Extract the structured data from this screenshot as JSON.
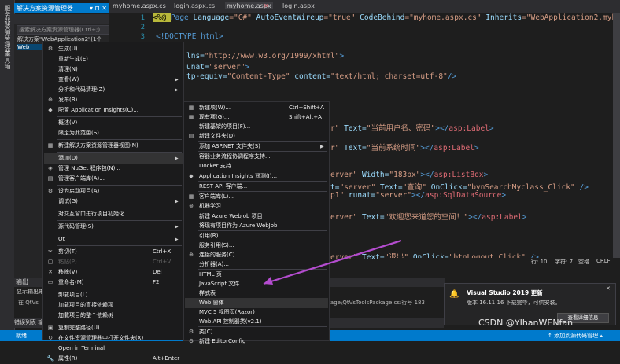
{
  "left_strip": {
    "label1": "服务器资源管理器",
    "label2": "工具箱"
  },
  "solution_explorer": {
    "title": "解决方案资源管理器",
    "search_placeholder": "搜索解决方案资源管理器(Ctrl+;)",
    "solution_label": "解决方案\"WebApplication2\"(1个",
    "project_label": "Web",
    "controls": "▾ ⊓ ✕"
  },
  "tabs": [
    {
      "label": "myhome.aspx.cs"
    },
    {
      "label": "login.aspx.cs"
    },
    {
      "label": "myhome.aspx"
    },
    {
      "label": "login.aspx"
    }
  ],
  "tab_close": "✕",
  "line_numbers": [
    "1",
    "2",
    "3"
  ],
  "code": {
    "line1": [
      "<%@ ",
      "Page ",
      "Language",
      "=\"C#\" ",
      "AutoEventWireup",
      "=\"true\" ",
      "CodeBehind",
      "=\"myhome.aspx.cs\" ",
      "Inherits",
      "=\"WebApplication2.myhome\" ",
      "%>"
    ],
    "line3": "<!DOCTYPE html>",
    "l_xmlns": [
      "lns=",
      "\"http://www.w3.org/1999/xhtml\"",
      ">"
    ],
    "l_runat": [
      "unat=",
      "\"server\"",
      ">"
    ],
    "l_meta": [
      "tp-equiv=",
      "\"Content-Type\" ",
      "content=",
      "\"text/html; charset=utf-8\"",
      "/>"
    ],
    "l_label1": [
      "r\" ",
      "Text=",
      "\"当前用户名、密码\"",
      "></",
      "asp:Label",
      ">"
    ],
    "l_label2": [
      "r\" ",
      "Text=",
      "\"当前系统时间\"",
      "></",
      "asp:Label",
      ">"
    ],
    "l_listbox": [
      "erver\" ",
      "Width=",
      "\"183px\"",
      "></",
      "asp:ListBox",
      ">"
    ],
    "l_button": [
      "t=",
      "\"server\" ",
      "Text=",
      "\"查询\" ",
      "OnClick=",
      "\"bynSearchMyclass_Click\"",
      " />"
    ],
    "l_sql": [
      "p1\" ",
      "runat=",
      "\"server\"",
      "></",
      "asp:SqlDataSource",
      ">"
    ],
    "l_welcome": [
      "erver\" ",
      "Text=",
      "\"欢迎您来道您的空间！\"",
      "></",
      "asp:Label",
      ">"
    ],
    "l_logout": [
      "erver\" ",
      "Text=",
      "\"退出\" ",
      "OnClick=",
      "\"btnLogout_Click\"",
      " />"
    ]
  },
  "editor_status": {
    "line": "行: 10",
    "char": "字符: 7",
    "space": "空格",
    "crlf": "CRLF"
  },
  "output": {
    "title": "输出",
    "show_from": "显示输出来",
    "line1": "在 QtVs",
    "line2": "kage\\QtVsToolsPackage.cs:行号 183",
    "tabs": "错误列表  输出"
  },
  "statusbar": {
    "left": "就绪",
    "right": "↑ 添加到源代码管理 ▴"
  },
  "context_menu": {
    "items": [
      {
        "icon": "⚙",
        "label": "生成(U)",
        "shortcut": "",
        "arrow": false
      },
      {
        "icon": "",
        "label": "重新生成(E)",
        "shortcut": "",
        "arrow": false
      },
      {
        "icon": "",
        "label": "清理(N)",
        "shortcut": "",
        "arrow": false
      },
      {
        "icon": "",
        "label": "查看(W)",
        "shortcut": "",
        "arrow": true
      },
      {
        "icon": "",
        "label": "分析和代码清理(Z)",
        "shortcut": "",
        "arrow": true
      },
      {
        "icon": "⊕",
        "label": "发布(B)...",
        "shortcut": "",
        "arrow": false
      },
      {
        "icon": "◆",
        "label": "配置 Application Insights(C)...",
        "shortcut": "",
        "arrow": false
      },
      {
        "icon": "",
        "label": "概述(V)",
        "shortcut": "",
        "arrow": false
      },
      {
        "icon": "",
        "label": "限定为此范围(S)",
        "shortcut": "",
        "arrow": false
      },
      {
        "icon": "▦",
        "label": "新建解决方案资源管理器视图(N)",
        "shortcut": "",
        "arrow": false
      },
      {
        "icon": "",
        "label": "添加(D)",
        "shortcut": "",
        "arrow": true
      },
      {
        "icon": "◈",
        "label": "管理 NuGet 程序包(N)...",
        "shortcut": "",
        "arrow": false
      },
      {
        "icon": "▤",
        "label": "管理客户端库(A)...",
        "shortcut": "",
        "arrow": false
      },
      {
        "icon": "⚙",
        "label": "设为启动项目(A)",
        "shortcut": "",
        "arrow": false
      },
      {
        "icon": "",
        "label": "调试(G)",
        "shortcut": "",
        "arrow": true
      },
      {
        "icon": "",
        "label": "对交互窗口进行项目初始化",
        "shortcut": "",
        "arrow": false
      },
      {
        "icon": "",
        "label": "源代码管理(S)",
        "shortcut": "",
        "arrow": true
      },
      {
        "icon": "",
        "label": "Qt",
        "shortcut": "",
        "arrow": true
      },
      {
        "icon": "✂",
        "label": "剪切(T)",
        "shortcut": "Ctrl+X",
        "arrow": false
      },
      {
        "icon": "▢",
        "label": "粘贴(P)",
        "shortcut": "Ctrl+V",
        "arrow": false
      },
      {
        "icon": "✕",
        "label": "移除(V)",
        "shortcut": "Del",
        "arrow": false
      },
      {
        "icon": "▭",
        "label": "重命名(M)",
        "shortcut": "F2",
        "arrow": false
      },
      {
        "icon": "",
        "label": "卸载项目(L)",
        "shortcut": "",
        "arrow": false
      },
      {
        "icon": "",
        "label": "加载项目的直接依赖项",
        "shortcut": "",
        "arrow": false
      },
      {
        "icon": "",
        "label": "加载项目的整个依赖树",
        "shortcut": "",
        "arrow": false
      },
      {
        "icon": "▣",
        "label": "复制完整路径(U)",
        "shortcut": "",
        "arrow": false
      },
      {
        "icon": "↻",
        "label": "在文件资源管理器中打开文件夹(X)",
        "shortcut": "",
        "arrow": false
      },
      {
        "icon": "",
        "label": "Open in Terminal",
        "shortcut": "",
        "arrow": false
      },
      {
        "icon": "🔧",
        "label": "属性(R)",
        "shortcut": "Alt+Enter",
        "arrow": false
      }
    ]
  },
  "add_submenu": {
    "items": [
      {
        "icon": "▦",
        "label": "新建项(W)...",
        "shortcut": "Ctrl+Shift+A"
      },
      {
        "icon": "▦",
        "label": "现有项(G)...",
        "shortcut": "Shift+Alt+A"
      },
      {
        "icon": "",
        "label": "新建基架的项目(F)...",
        "shortcut": ""
      },
      {
        "icon": "▤",
        "label": "新建文件夹(D)",
        "shortcut": ""
      },
      {
        "icon": "",
        "label": "添加 ASP.NET 文件夹(S)",
        "shortcut": "",
        "arrow": true
      },
      {
        "icon": "",
        "label": "容器业务流程协调程序支持...",
        "shortcut": ""
      },
      {
        "icon": "",
        "label": "Docker 支持...",
        "shortcut": ""
      },
      {
        "icon": "◆",
        "label": "Application Insights 遥测(I)...",
        "shortcut": ""
      },
      {
        "icon": "",
        "label": "REST API 客户端...",
        "shortcut": ""
      },
      {
        "icon": "▦",
        "label": "客户端库(L)...",
        "shortcut": ""
      },
      {
        "icon": "⊛",
        "label": "机器学习",
        "shortcut": ""
      },
      {
        "icon": "",
        "label": "新建 Azure WebJob 项目",
        "shortcut": ""
      },
      {
        "icon": "",
        "label": "将现有项目作为 Azure WebJob",
        "shortcut": ""
      },
      {
        "icon": "",
        "label": "引用(R)...",
        "shortcut": ""
      },
      {
        "icon": "",
        "label": "服务引用(S)...",
        "shortcut": ""
      },
      {
        "icon": "⊕",
        "label": "连接的服务(C)",
        "shortcut": ""
      },
      {
        "icon": "",
        "label": "分析器(A)...",
        "shortcut": ""
      },
      {
        "icon": "",
        "label": "HTML 页",
        "shortcut": ""
      },
      {
        "icon": "",
        "label": "JavaScript 文件",
        "shortcut": ""
      },
      {
        "icon": "",
        "label": "样式表",
        "shortcut": ""
      },
      {
        "icon": "",
        "label": "Web 窗体",
        "shortcut": ""
      },
      {
        "icon": "",
        "label": "MVC 5 视图页(Razor)",
        "shortcut": ""
      },
      {
        "icon": "",
        "label": "Web API 控制器类(v2.1)",
        "shortcut": ""
      },
      {
        "icon": "⚙",
        "label": "类(C)...",
        "shortcut": ""
      },
      {
        "icon": "⚙",
        "label": "新建 EditorConfig",
        "shortcut": ""
      }
    ]
  },
  "notification": {
    "title": "Visual Studio 2019 更新",
    "text": "版本 16.11.16 下载完毕，可供安装。",
    "button": "查看详细信息",
    "close": "✕"
  },
  "watermark": "CSDN @YIhanWENfan"
}
